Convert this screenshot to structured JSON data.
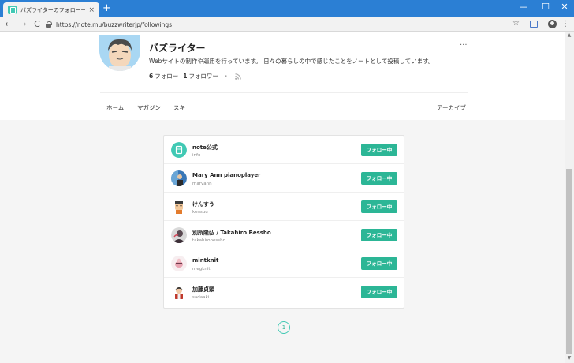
{
  "browser": {
    "tab_title": "バズライターのフォロー一覧｜note",
    "tab_close": "×",
    "new_tab": "+",
    "url": "https://note.mu/buzzwriterjp/followings",
    "back": "←",
    "forward": "→",
    "reload": "C",
    "star": "☆",
    "menu": "⋮",
    "minimize": "—",
    "maximize": "☐",
    "close": "✕"
  },
  "creator": {
    "name": "バズライター",
    "description": "Webサイトの制作や運用を行っています。 日々の暮らしの中で感じたことをノートとして投稿しています。",
    "follow_count": "6",
    "follow_label": "フォロー",
    "follower_count": "1",
    "follower_label": "フォロワー",
    "separator": "・",
    "more": "···"
  },
  "page_tabs": {
    "home": "ホーム",
    "magazine": "マガジン",
    "likes": "スキ",
    "archive": "アーカイブ"
  },
  "followings": [
    {
      "name": "note公式",
      "id": "info",
      "button": "フォロー中",
      "avatar": "note-logo"
    },
    {
      "name": "Mary Ann pianoplayer",
      "id": "maryann",
      "button": "フォロー中",
      "avatar": "photo-blue"
    },
    {
      "name": "けんすう",
      "id": "kensuu",
      "button": "フォロー中",
      "avatar": "illustration-orange"
    },
    {
      "name": "別所隆弘 / Takahiro Bessho",
      "id": "takahirobessho",
      "button": "フォロー中",
      "avatar": "photo-dark"
    },
    {
      "name": "mintknit",
      "id": "megknit",
      "button": "フォロー中",
      "avatar": "illustration-pink"
    },
    {
      "name": "加藤貞顕",
      "id": "sadaaki",
      "button": "フォロー中",
      "avatar": "illustration-red"
    }
  ],
  "pagination": {
    "current": "1"
  },
  "colors": {
    "accent": "#2cb696",
    "titlebar": "#2b7fd4",
    "note_brand": "#41c9b4"
  }
}
